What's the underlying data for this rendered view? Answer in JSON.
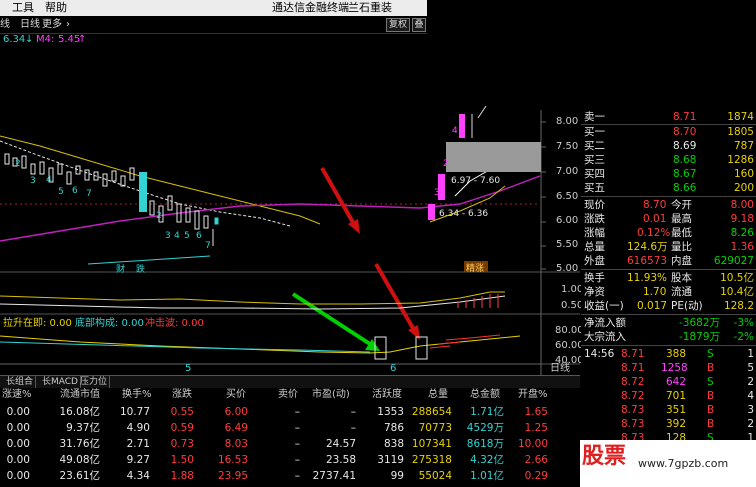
{
  "menubar": {
    "tools": "工具",
    "help": "帮助",
    "title": "通达信金融终端",
    "restore_label": "兰石重装"
  },
  "chart_toolbar": {
    "period": "线",
    "indicator": "日线",
    "more": "更多",
    "more_arrow": "›",
    "restore_btn": "复权",
    "overlay_btn": "叠"
  },
  "ma_row": {
    "ma1_value": "6.34",
    "ma1_arrow": "↓",
    "ma2_label": "M4:",
    "ma2_value": "5.45",
    "ma2_arrow": "↑"
  },
  "price_axis": [
    "8.00",
    "7.50",
    "7.00",
    "6.50",
    "6.00",
    "5.50",
    "5.00"
  ],
  "price_annotations": {
    "box1": "6.97 - 7.60",
    "box2": "6.34 - 6.36",
    "num4": "4",
    "num3": "3",
    "num2": "2"
  },
  "candle_numbers": [
    "2",
    "3",
    "4",
    "5",
    "6",
    "7",
    "2",
    "3",
    "4",
    "5",
    "6",
    "7"
  ],
  "markers": {
    "cai": "财",
    "die": "跌",
    "jing_zhang": "精涨"
  },
  "volume_axis": [
    "1.00",
    "0.50"
  ],
  "lower_indicator": {
    "label1": "拉升在即: 0.00",
    "label2": "底部构成: 0.00",
    "label3": "冲击波: 0.00",
    "axis": [
      "80.00",
      "60.00",
      "40.00"
    ]
  },
  "time_axis": {
    "m1": "5",
    "m2": "6",
    "period": "日线"
  },
  "tabs": [
    "长组合",
    "长MACD",
    "压力位"
  ],
  "quote": {
    "sells": [
      {
        "label": "卖一",
        "price": "8.71",
        "vol": "1874"
      },
      {
        "label": "买一",
        "price": "8.70",
        "vol": "1805"
      },
      {
        "label": "买二",
        "price": "8.69",
        "vol": "787"
      },
      {
        "label": "买三",
        "price": "8.68",
        "vol": "1286"
      },
      {
        "label": "买四",
        "price": "8.67",
        "vol": "160"
      },
      {
        "label": "买五",
        "price": "8.66",
        "vol": "200"
      }
    ],
    "stats": [
      {
        "l1": "现价",
        "v1": "8.70",
        "l2": "今开",
        "v2": "8.00"
      },
      {
        "l1": "涨跌",
        "v1": "0.01",
        "l2": "最高",
        "v2": "9.18"
      },
      {
        "l1": "涨幅",
        "v1": "0.12%",
        "l2": "最低",
        "v2": "8.26"
      },
      {
        "l1": "总量",
        "v1": "124.6万",
        "l2": "量比",
        "v2": "1.36"
      },
      {
        "l1": "外盘",
        "v1": "616573",
        "l2": "内盘",
        "v2": "629027"
      }
    ],
    "stats2": [
      {
        "l1": "换手",
        "v1": "11.93%",
        "l2": "股本",
        "v2": "10.5亿"
      },
      {
        "l1": "净资",
        "v1": "1.70",
        "l2": "流通",
        "v2": "10.4亿"
      },
      {
        "l1": "收益(一)",
        "v1": "0.017",
        "l2": "PE(动)",
        "v2": "128.2"
      }
    ],
    "flows": [
      {
        "label": "净流入额",
        "value": "-3682万",
        "pct": "-3%"
      },
      {
        "label": "大宗流入",
        "value": "-1879万",
        "pct": "-2%"
      }
    ],
    "ticks": [
      {
        "time": "14:56",
        "price": "8.71",
        "vol": "388",
        "side": "S",
        "n": "1"
      },
      {
        "time": "",
        "price": "8.71",
        "vol": "1258",
        "side": "B",
        "n": "5"
      },
      {
        "time": "",
        "price": "8.72",
        "vol": "642",
        "side": "S",
        "n": "2"
      },
      {
        "time": "",
        "price": "8.72",
        "vol": "701",
        "side": "B",
        "n": "4"
      },
      {
        "time": "",
        "price": "8.73",
        "vol": "351",
        "side": "B",
        "n": "3"
      },
      {
        "time": "",
        "price": "8.73",
        "vol": "392",
        "side": "B",
        "n": "2"
      },
      {
        "time": "",
        "price": "8.73",
        "vol": "128",
        "side": "S",
        "n": "1"
      }
    ]
  },
  "table": {
    "headers": [
      "涨速%",
      "流通市值",
      "换手%",
      "涨跌",
      "买价",
      "卖价",
      "市盈(动)",
      "活跃度",
      "总量",
      "总金额",
      "开盘%"
    ],
    "rows": [
      [
        "0.00",
        "16.08亿",
        "10.77",
        "0.55",
        "6.00",
        "–",
        "–",
        "1353",
        "288654",
        "1.71亿",
        "1.65"
      ],
      [
        "0.00",
        "9.37亿",
        "4.90",
        "0.59",
        "6.49",
        "–",
        "–",
        "786",
        "70773",
        "4529万",
        "1.25"
      ],
      [
        "0.00",
        "31.76亿",
        "2.71",
        "0.73",
        "8.03",
        "–",
        "24.57",
        "838",
        "107341",
        "8618万",
        "10.00"
      ],
      [
        "0.00",
        "49.08亿",
        "9.27",
        "1.50",
        "16.53",
        "–",
        "23.58",
        "3119",
        "275318",
        "4.32亿",
        "2.66"
      ],
      [
        "0.00",
        "23.61亿",
        "4.34",
        "1.88",
        "23.95",
        "–",
        "2737.41",
        "99",
        "55024",
        "1.01亿",
        "0.29"
      ]
    ]
  },
  "watermark": {
    "logo": "股票",
    "url": "www.7gpzb.com"
  }
}
